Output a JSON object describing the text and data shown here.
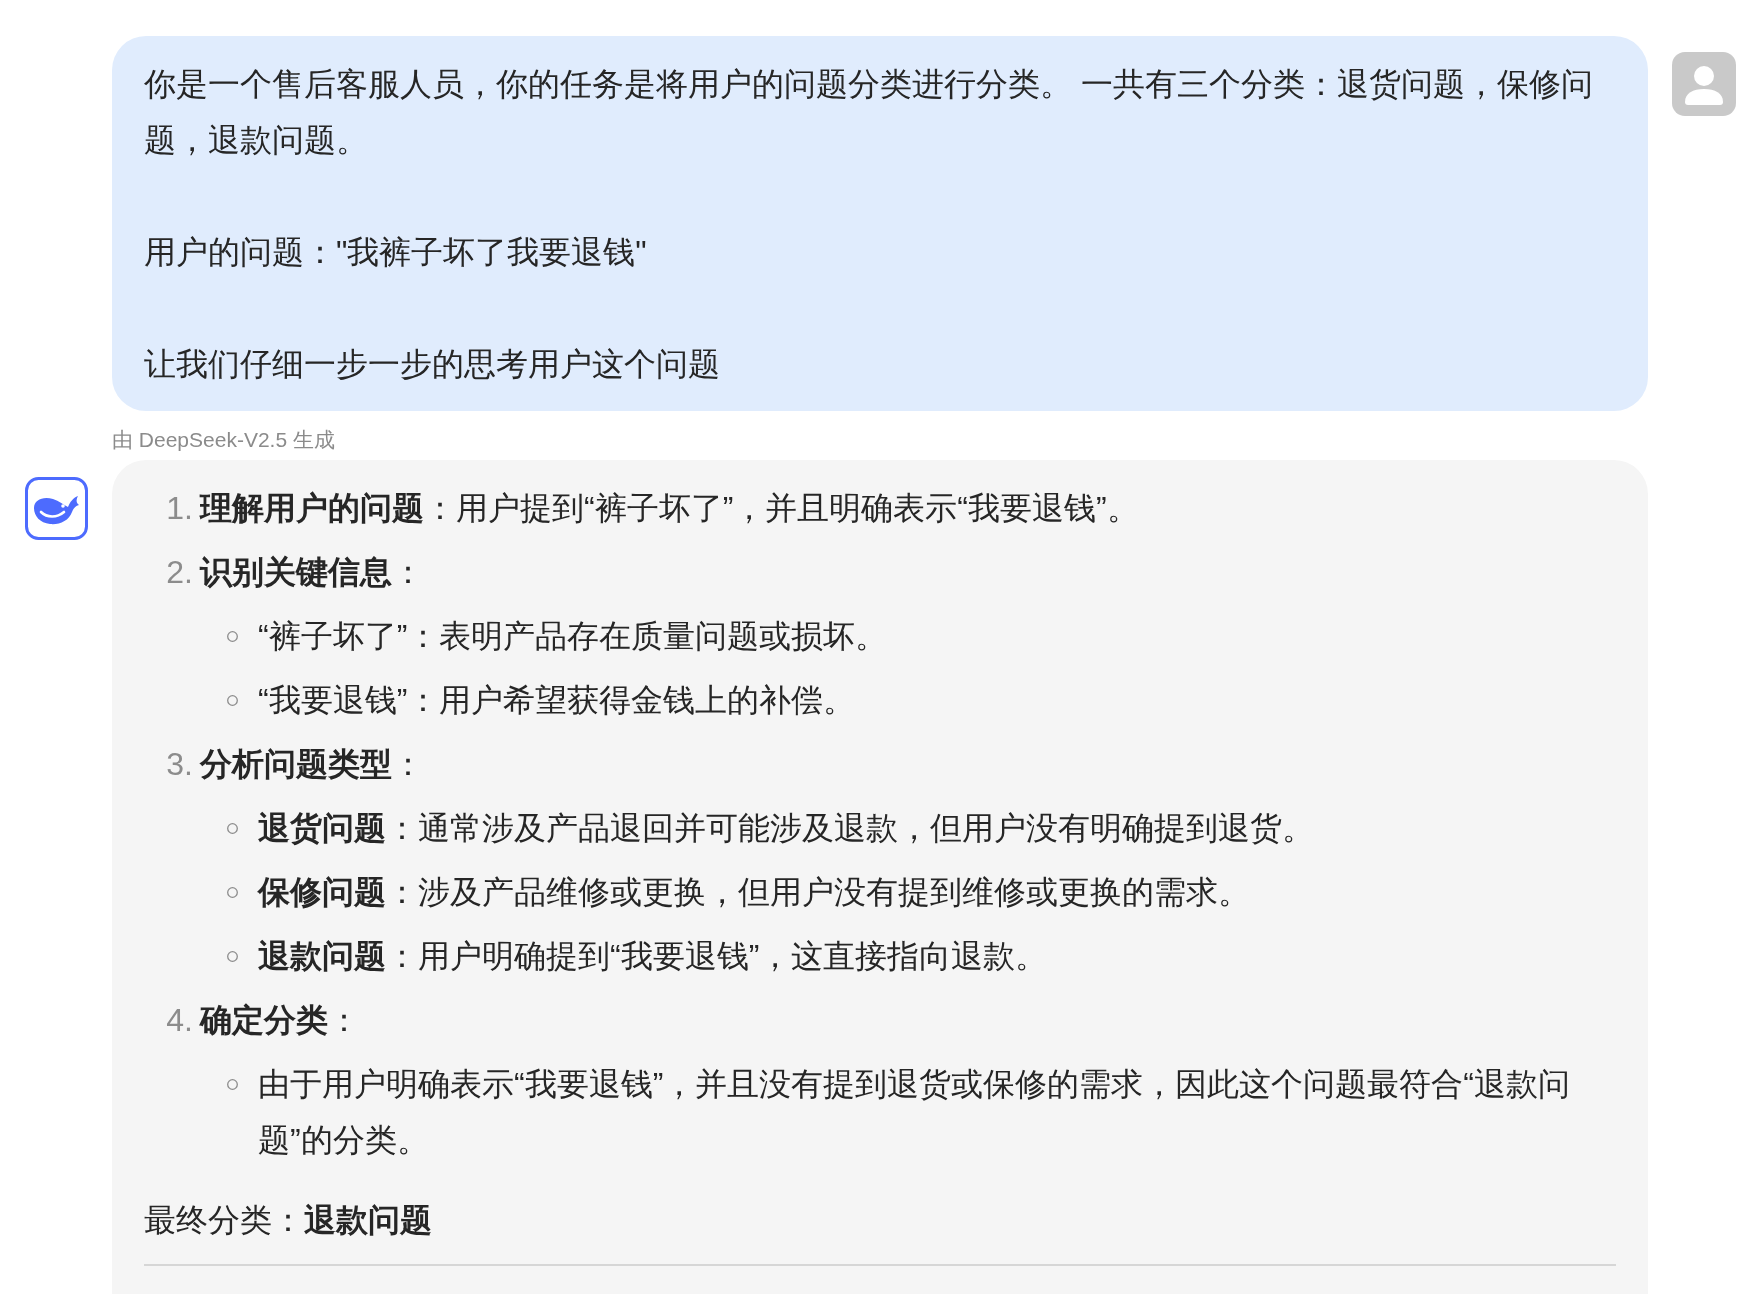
{
  "user_message": {
    "paragraphs": [
      "你是一个售后客服人员，你的任务是将用户的问题分类进行分类。 一共有三个分类：退货问题，保修问题，退款问题。",
      "用户的问题：\"我裤子坏了我要退钱\"",
      "让我们仔细一步一步的思考用户这个问题"
    ]
  },
  "model_label": "由 DeepSeek-V2.5 生成",
  "assistant_message": {
    "steps": [
      {
        "number": "1.",
        "text": "**理解用户的问题**：用户提到“裤子坏了”，并且明确表示“我要退钱”。"
      },
      {
        "number": "2.",
        "text": "**识别关键信息**：",
        "children": [
          {
            "text": "“裤子坏了”：表明产品存在质量问题或损坏。"
          },
          {
            "text": "“我要退钱”：用户希望获得金钱上的补偿。"
          }
        ]
      },
      {
        "number": "3.",
        "text": "**分析问题类型**：",
        "children": [
          {
            "text": "**退货问题**：通常涉及产品退回并可能涉及退款，但用户没有明确提到退货。"
          },
          {
            "text": "**保修问题**：涉及产品维修或更换，但用户没有提到维修或更换的需求。"
          },
          {
            "text": "**退款问题**：用户明确提到“我要退钱”，这直接指向退款。"
          }
        ]
      },
      {
        "number": "4.",
        "text": "**确定分类**：",
        "children": [
          {
            "text": "由于用户明确表示“我要退钱”，并且没有提到退货或保修的需求，因此这个问题最符合“退款问题”的分类。"
          }
        ]
      }
    ],
    "conclusion": "最终分类：**退款问题**"
  }
}
